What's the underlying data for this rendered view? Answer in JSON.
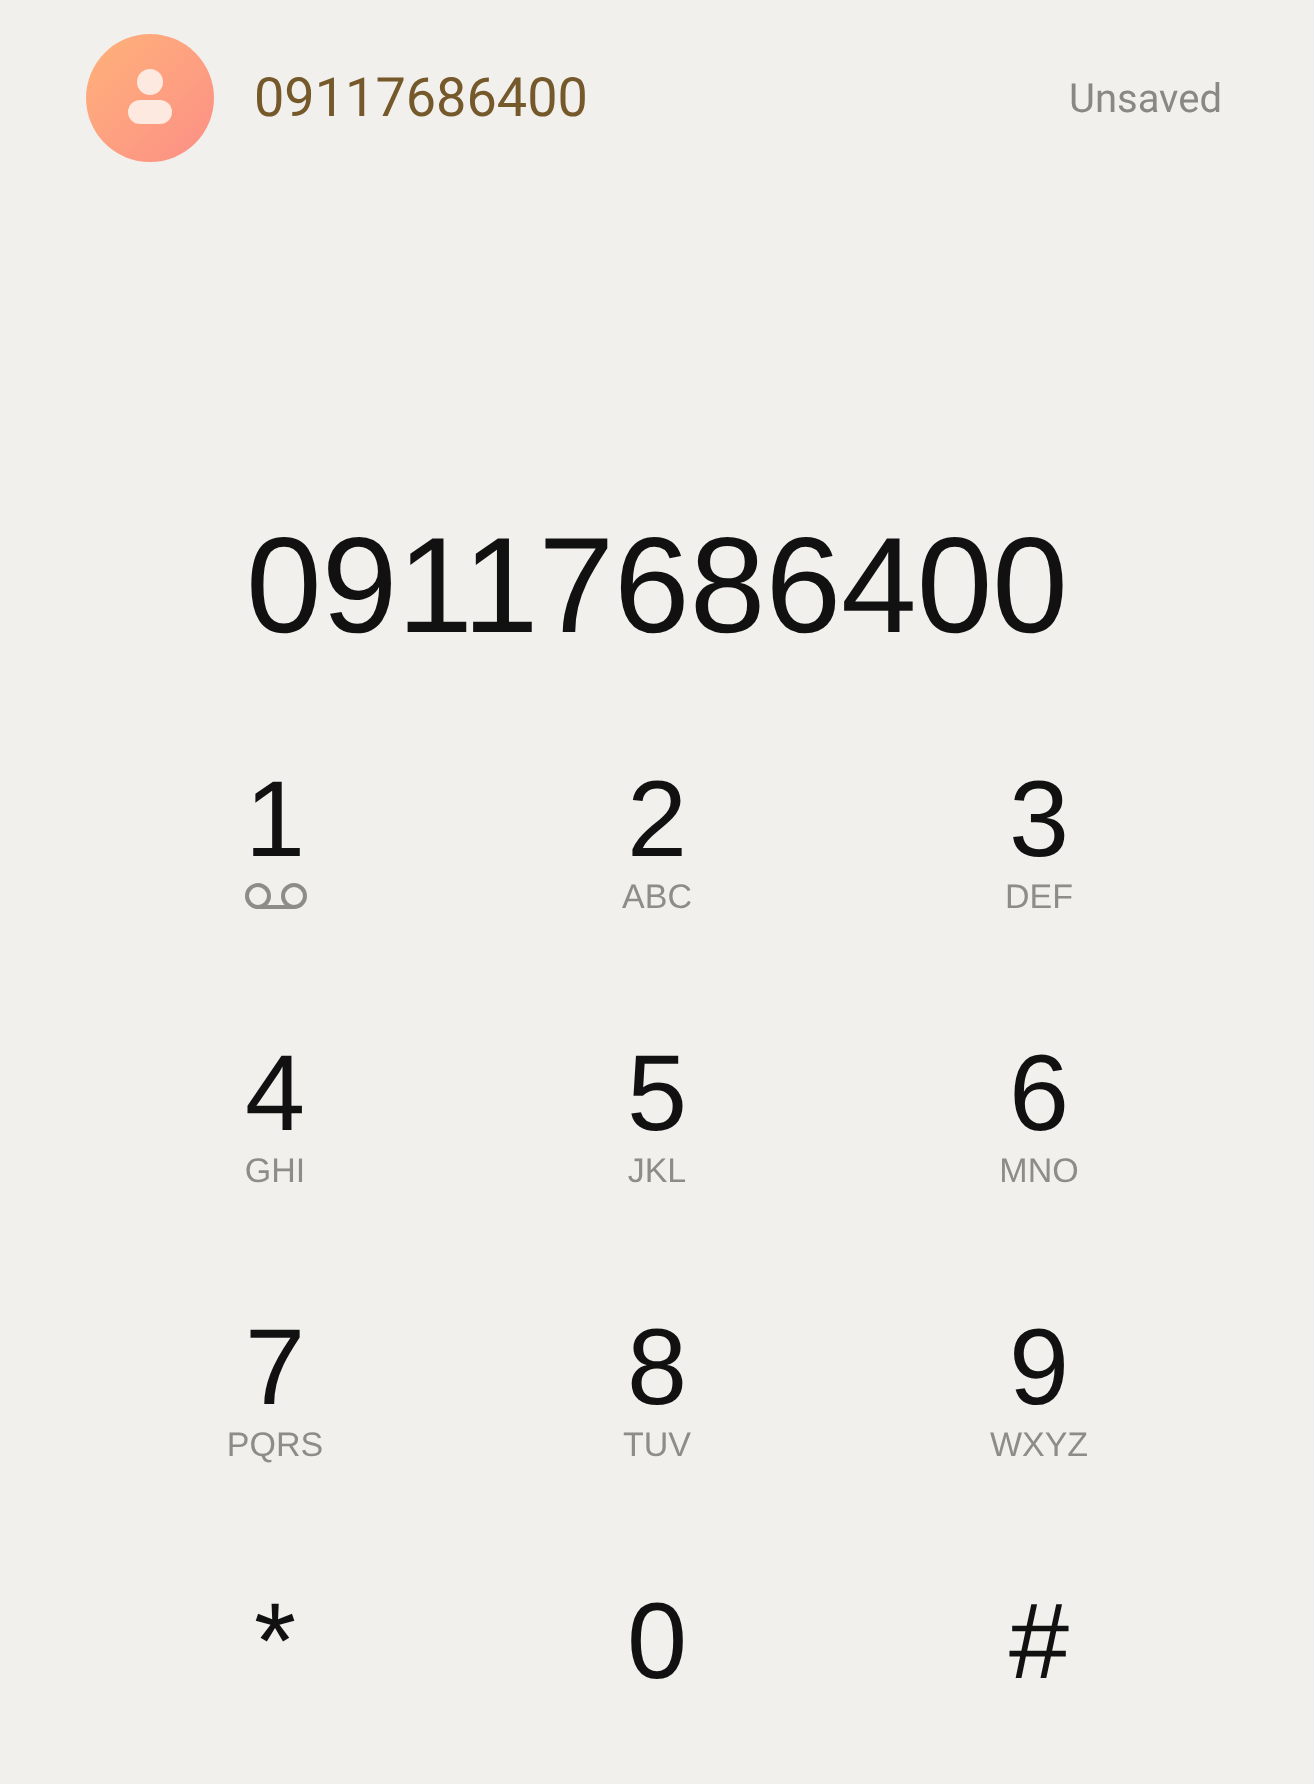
{
  "contact": {
    "number": "09117686400",
    "status": "Unsaved"
  },
  "display": {
    "number": "09117686400"
  },
  "keys": [
    {
      "digit": "1",
      "kind": "voicemail"
    },
    {
      "digit": "2",
      "kind": "letters",
      "letters": "ABC"
    },
    {
      "digit": "3",
      "kind": "letters",
      "letters": "DEF"
    },
    {
      "digit": "4",
      "kind": "letters",
      "letters": "GHI"
    },
    {
      "digit": "5",
      "kind": "letters",
      "letters": "JKL"
    },
    {
      "digit": "6",
      "kind": "letters",
      "letters": "MNO"
    },
    {
      "digit": "7",
      "kind": "letters",
      "letters": "PQRS"
    },
    {
      "digit": "8",
      "kind": "letters",
      "letters": "TUV"
    },
    {
      "digit": "9",
      "kind": "letters",
      "letters": "WXYZ"
    },
    {
      "digit": "*",
      "kind": "plain"
    },
    {
      "digit": "0",
      "kind": "plain"
    },
    {
      "digit": "#",
      "kind": "plain"
    }
  ]
}
